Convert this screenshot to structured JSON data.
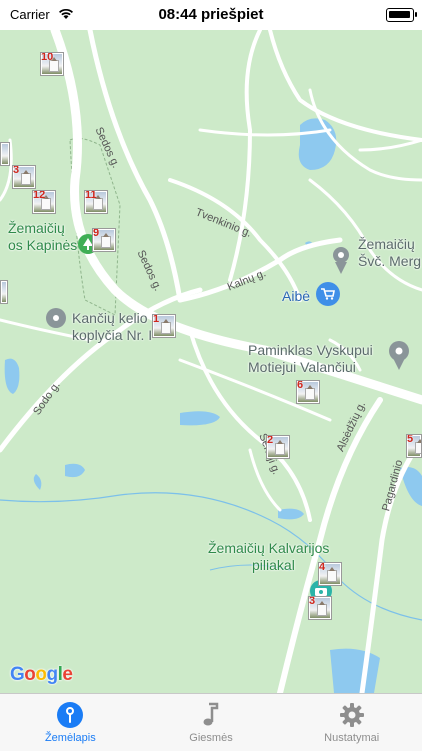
{
  "status_bar": {
    "carrier": "Carrier",
    "time": "08:44 priešpiet"
  },
  "map": {
    "roads": {
      "sedos_upper": "Sedos g.",
      "sedos_lower": "Sedos g.",
      "tvenkinio": "Tvenkinio g.",
      "kalnu": "Kalnų g.",
      "sodo": "Sodo g.",
      "senoji": "Senoji g.",
      "alsedziu": "Alsėdžių g.",
      "pagardinio": "Pagardinio"
    },
    "places": {
      "kapines_line1": "Žemaičių",
      "kapines_line2": "os Kapinės",
      "koplycia_line1": "Kančių kelio",
      "koplycia_line2": "koplyčia Nr. I",
      "church_line1": "Žemaičių",
      "church_line2": "Švč. Merg",
      "aibe": "Aibė",
      "paminklas_line1": "Paminklas Vyskupui",
      "paminklas_line2": "Motiejui Valančiui",
      "piliakal_line1": "Žemaičių Kalvarijos",
      "piliakal_line2": "piliakal"
    },
    "markers": [
      "10",
      "3",
      "12",
      "11",
      "9",
      "1",
      "6",
      "2",
      "4",
      "3",
      "5"
    ],
    "attribution": "Google"
  },
  "tab_bar": {
    "tabs": [
      {
        "label": "Žemėlapis",
        "icon": "map-pin-icon",
        "active": true
      },
      {
        "label": "Giesmės",
        "icon": "music-note-icon",
        "active": false
      },
      {
        "label": "Nustatymai",
        "icon": "gear-icon",
        "active": false
      }
    ]
  },
  "colors": {
    "accent": "#1a7cf5",
    "map_bg": "#cdeac9",
    "water": "#8ec9ef"
  }
}
